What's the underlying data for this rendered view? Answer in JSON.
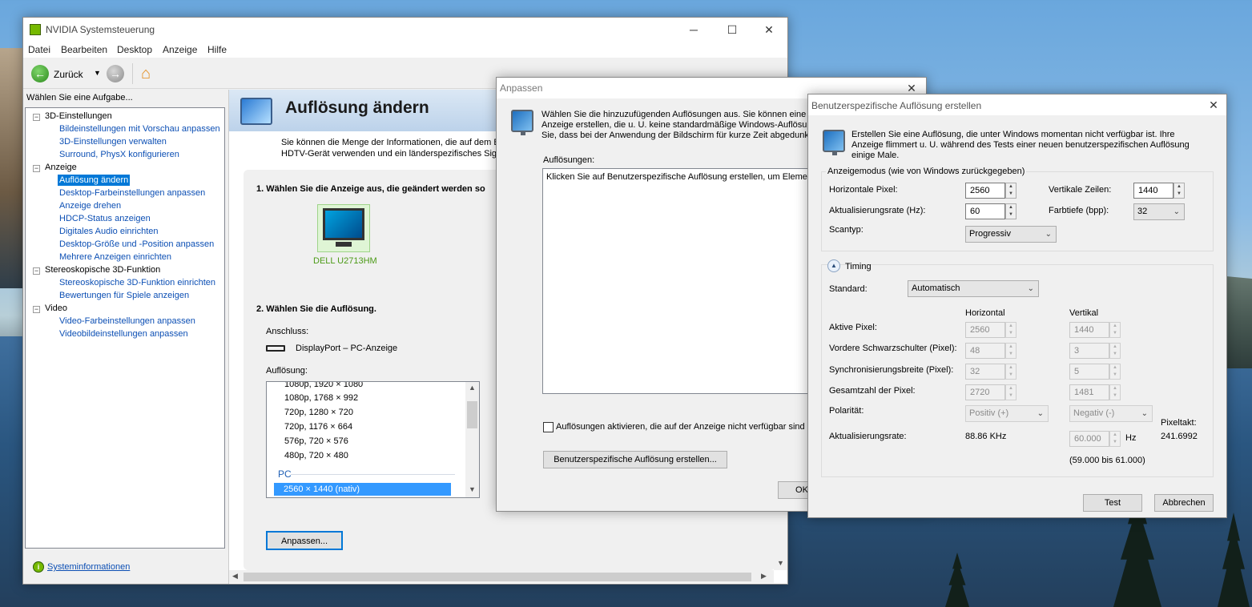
{
  "main_window": {
    "title": "NVIDIA Systemsteuerung",
    "menu": [
      "Datei",
      "Bearbeiten",
      "Desktop",
      "Anzeige",
      "Hilfe"
    ],
    "back_label": "Zurück",
    "task_prompt": "Wählen Sie eine Aufgabe...",
    "tree": {
      "cat_3d": "3D-Einstellungen",
      "items_3d": [
        "Bildeinstellungen mit Vorschau anpassen",
        "3D-Einstellungen verwalten",
        "Surround, PhysX konfigurieren"
      ],
      "cat_display": "Anzeige",
      "items_display": [
        "Auflösung ändern",
        "Desktop-Farbeinstellungen anpassen",
        "Anzeige drehen",
        "HDCP-Status anzeigen",
        "Digitales Audio einrichten",
        "Desktop-Größe und -Position anpassen",
        "Mehrere Anzeigen einrichten"
      ],
      "cat_stereo": "Stereoskopische 3D-Funktion",
      "items_stereo": [
        "Stereoskopische 3D-Funktion einrichten",
        "Bewertungen für Spiele anzeigen"
      ],
      "cat_video": "Video",
      "items_video": [
        "Video-Farbeinstellungen anpassen",
        "Videobildeinstellungen anpassen"
      ]
    },
    "system_info": "Systeminformationen",
    "page_title": "Auflösung ändern",
    "intro_line1": "Sie können die Menge der Informationen, die auf dem Bild",
    "intro_line2": "HDTV-Gerät verwenden und ein länderspezifisches Signa",
    "step1": "1. Wählen Sie die Anzeige aus, die geändert werden so",
    "monitor_name": "DELL U2713HM",
    "step2": "2. Wählen Sie die Auflösung.",
    "connection_label": "Anschluss:",
    "connection_value": "DisplayPort – PC-Anzeige",
    "resolution_label": "Auflösung:",
    "resolutions": [
      "1080p, 1920 × 1080",
      "1080p, 1768 × 992",
      "720p, 1280 × 720",
      "720p, 1176 × 664",
      "576p, 720 × 576",
      "480p, 720 × 480"
    ],
    "pc_group": "PC",
    "selected_resolution": "2560 × 1440 (nativ)",
    "customize_button": "Anpassen..."
  },
  "customize_dialog": {
    "title": "Anpassen",
    "intro_line1": "Wählen Sie die hinzuzufügenden Auflösungen aus. Sie können eine be",
    "intro_line2": "Anzeige erstellen, die u. U. keine standardmäßige Windows-Auflösung",
    "intro_line3": "Sie, dass bei der Anwendung der Bildschirm für kurze Zeit abgedunkel",
    "resolutions_label": "Auflösungen:",
    "list_hint": "Klicken Sie auf Benutzerspezifische Auflösung erstellen, um Elemente",
    "checkbox_label": "Auflösungen aktivieren, die auf der Anzeige nicht verfügbar sind",
    "create_button": "Benutzerspezifische Auflösung erstellen...",
    "ok_button": "OK"
  },
  "custom_dialog": {
    "title": "Benutzerspezifische Auflösung erstellen",
    "intro_line1": "Erstellen Sie eine Auflösung, die unter Windows momentan nicht verfügbar ist. Ihre",
    "intro_line2": "Anzeige flimmert u. U. während des Tests einer neuen benutzerspezifischen Auflösung",
    "intro_line3": "einige Male.",
    "mode_group": "Anzeigemodus (wie von Windows zurückgegeben)",
    "h_pixels_label": "Horizontale Pixel:",
    "h_pixels": "2560",
    "v_lines_label": "Vertikale Zeilen:",
    "v_lines": "1440",
    "refresh_label": "Aktualisierungsrate (Hz):",
    "refresh": "60",
    "depth_label": "Farbtiefe (bpp):",
    "depth": "32",
    "scan_label": "Scantyp:",
    "scan": "Progressiv",
    "timing_label": "Timing",
    "standard_label": "Standard:",
    "standard": "Automatisch",
    "col_h": "Horizontal",
    "col_v": "Vertikal",
    "active_label": "Aktive Pixel:",
    "active_h": "2560",
    "active_v": "1440",
    "front_label": "Vordere Schwarzschulter (Pixel):",
    "front_h": "48",
    "front_v": "3",
    "sync_label": "Synchronisierungsbreite (Pixel):",
    "sync_h": "32",
    "sync_v": "5",
    "total_label": "Gesamtzahl der Pixel:",
    "total_h": "2720",
    "total_v": "1481",
    "polarity_label": "Polarität:",
    "polarity_h": "Positiv (+)",
    "polarity_v": "Negativ (-)",
    "rate_label": "Aktualisierungsrate:",
    "rate_h": "88.86 KHz",
    "rate_v": "60.000",
    "hz_unit": "Hz",
    "range": "(59.000 bis 61.000)",
    "pixel_clock_label": "Pixeltakt:",
    "pixel_clock": "241.6992",
    "test_button": "Test",
    "cancel_button": "Abbrechen"
  }
}
